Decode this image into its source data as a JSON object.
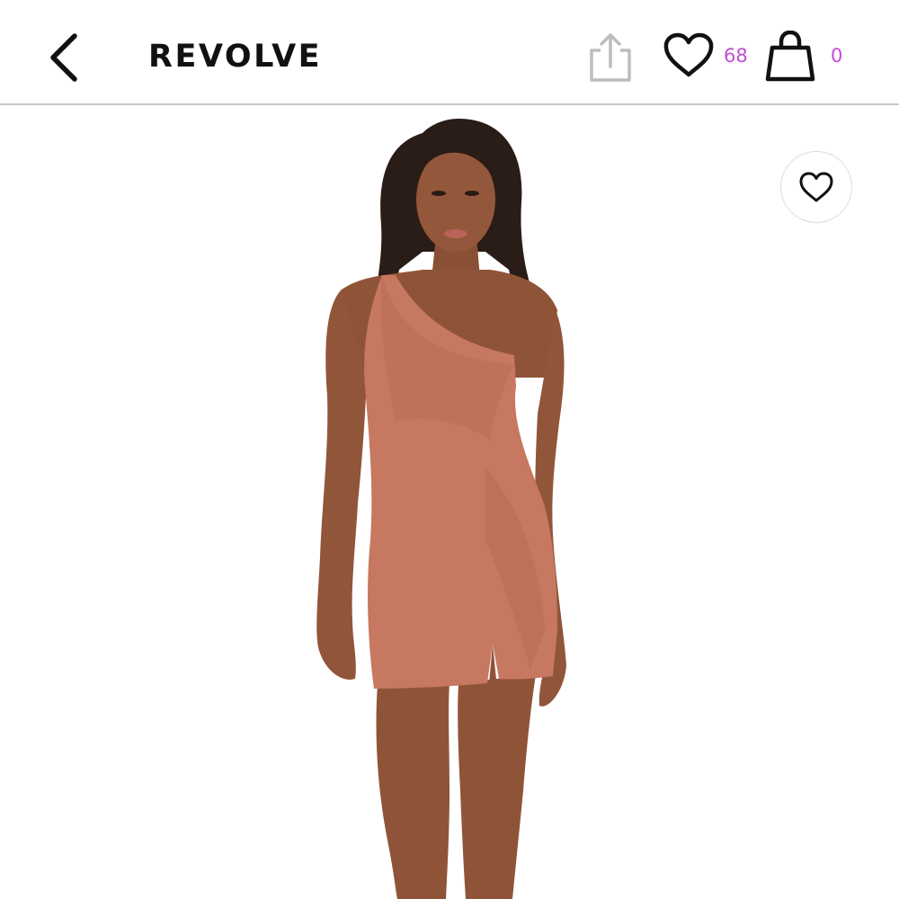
{
  "header": {
    "brand": "REVOLVE",
    "wishlist_count": "68",
    "bag_count": "0",
    "icons": {
      "back": "chevron-left-icon",
      "share": "share-icon",
      "wishlist": "heart-icon",
      "bag": "shopping-bag-icon"
    }
  },
  "product": {
    "dress_color": "#c77860",
    "favorite_icon": "heart-outline-icon"
  },
  "colors": {
    "count_accent": "#c44bd8",
    "share_icon_gray": "#bdbdbd",
    "divider": "#c9c9c9"
  }
}
